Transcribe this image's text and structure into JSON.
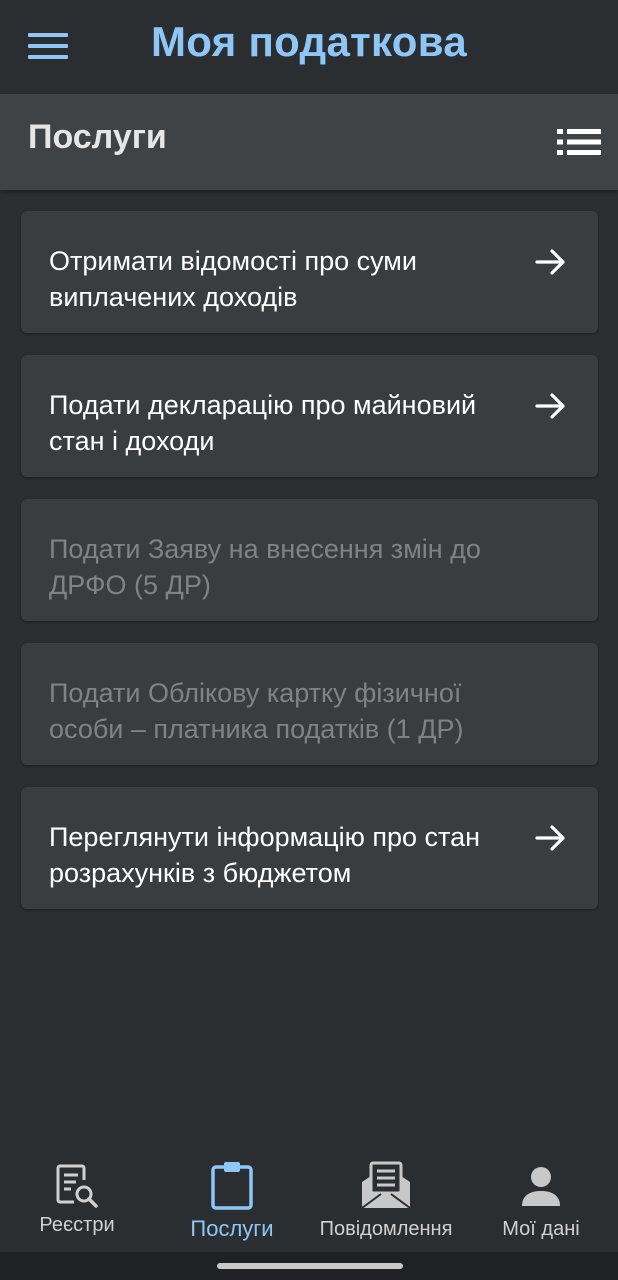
{
  "app_bar": {
    "title": "Моя податкова",
    "menu_icon": "hamburger-menu-icon",
    "title_color": "#8ec7f7"
  },
  "section": {
    "title": "Послуги",
    "view_icon": "list-view-icon"
  },
  "services": [
    {
      "label": "Отримати відомості про суми виплачених доходів",
      "enabled": true
    },
    {
      "label": "Подати декларацію про майновий стан і доходи",
      "enabled": true
    },
    {
      "label": "Подати Заяву на внесення змін до ДРФО (5 ДР)",
      "enabled": false
    },
    {
      "label": "Подати Облікову картку фізичної особи – платника податків (1 ДР)",
      "enabled": false
    },
    {
      "label": "Переглянути інформацію про стан розрахунків з бюджетом",
      "enabled": true
    }
  ],
  "bottom_nav": {
    "active": "Послуги",
    "active_color": "#8ec7f7",
    "items": [
      {
        "label": "Реєстри",
        "icon": "registry-search-icon"
      },
      {
        "label": "Послуги",
        "icon": "clipboard-icon"
      },
      {
        "label": "Повідомлення",
        "icon": "open-envelope-icon"
      },
      {
        "label": "Мої дані",
        "icon": "person-icon"
      }
    ]
  }
}
